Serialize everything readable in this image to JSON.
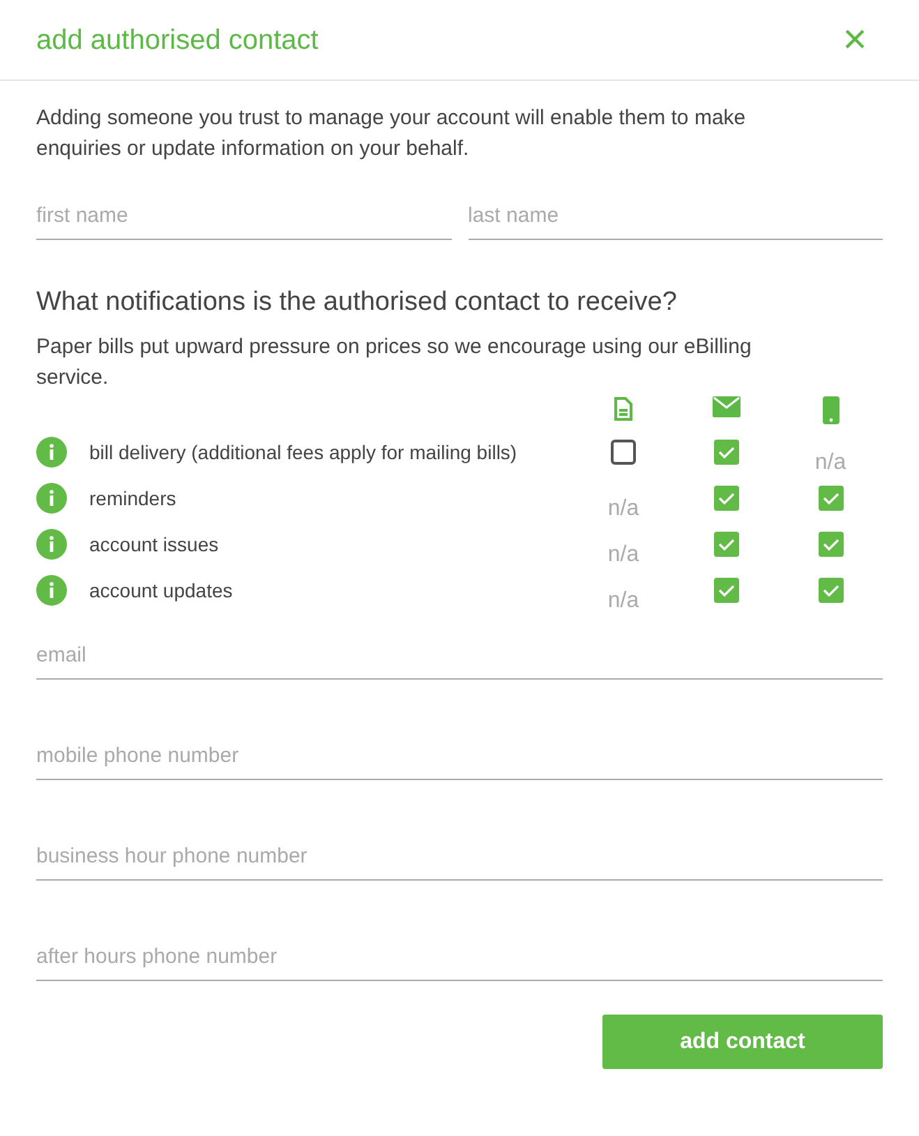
{
  "dialog": {
    "title": "add authorised contact",
    "close": "×"
  },
  "intro": "Adding someone you trust to manage your account will enable them to make enquiries or update information on your behalf.",
  "name_fields": [
    {
      "placeholder": "first name"
    },
    {
      "placeholder": "last name"
    }
  ],
  "notifications": {
    "heading": "What notifications is the authorised contact to receive?",
    "note": "Paper bills put upward pressure on prices so we encourage using our eBilling service.",
    "rows": [
      {
        "label": "bill delivery (additional fees apply for mailing bills)",
        "cells": [
          {
            "kind": "checkbox",
            "checked": false
          },
          {
            "kind": "checkbox",
            "checked": true
          },
          {
            "kind": "na",
            "text": "n/a"
          }
        ]
      },
      {
        "label": "reminders",
        "cells": [
          {
            "kind": "na",
            "text": "n/a"
          },
          {
            "kind": "checkbox",
            "checked": true
          },
          {
            "kind": "checkbox",
            "checked": true
          }
        ]
      },
      {
        "label": "account issues",
        "cells": [
          {
            "kind": "na",
            "text": "n/a"
          },
          {
            "kind": "checkbox",
            "checked": true
          },
          {
            "kind": "checkbox",
            "checked": true
          }
        ]
      },
      {
        "label": "account updates",
        "cells": [
          {
            "kind": "na",
            "text": "n/a"
          },
          {
            "kind": "checkbox",
            "checked": true
          },
          {
            "kind": "checkbox",
            "checked": true
          }
        ]
      }
    ]
  },
  "contact_fields": [
    {
      "placeholder": "email"
    },
    {
      "placeholder": "mobile phone number"
    },
    {
      "placeholder": "business hour phone number"
    },
    {
      "placeholder": "after hours phone number"
    }
  ],
  "submit": "add contact"
}
